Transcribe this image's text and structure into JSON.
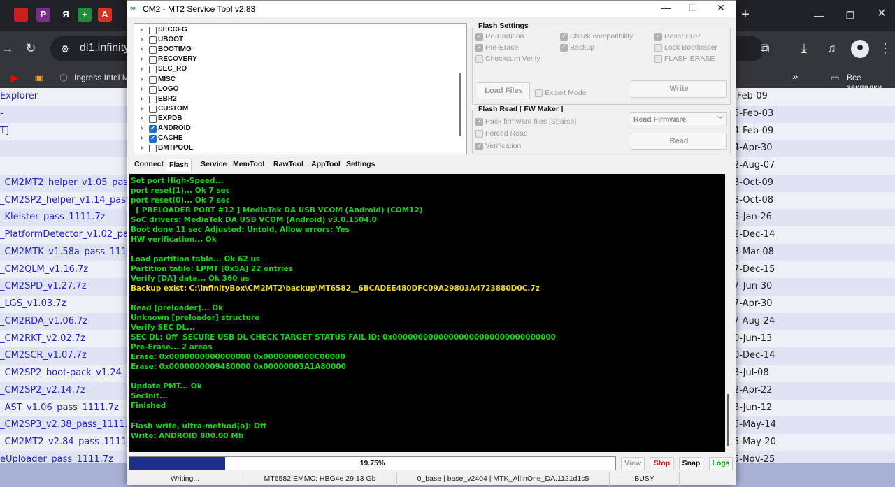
{
  "browser": {
    "tab_icons": [
      {
        "name": "tab-p",
        "glyph": "P",
        "color": "#7b2d8e"
      },
      {
        "name": "tab-y",
        "glyph": "Я",
        "color": "#202124"
      },
      {
        "name": "tab-plus",
        "glyph": "+",
        "color": "#1e8e3e"
      },
      {
        "name": "tab-a",
        "glyph": "A",
        "color": "#d93025"
      }
    ],
    "new_tab_symbol": "+",
    "address": "dl1.infinity",
    "bookmarks": [
      {
        "label": "Ingress Intel Ma"
      }
    ],
    "all_bookmarks_label": "Все закладки",
    "overflow_symbol": "»"
  },
  "page": {
    "rows": [
      {
        "name": "Explorer",
        "date": "-Feb-09",
        "alt": false
      },
      {
        "name": "-",
        "date": "5-Feb-03",
        "alt": true
      },
      {
        "name": "T]",
        "date": "4-Feb-09",
        "alt": false
      },
      {
        "name": "",
        "date": "4-Apr-30",
        "alt": true
      },
      {
        "name": "",
        "date": "2-Aug-07",
        "alt": false
      },
      {
        "name": "_CM2MT2_helper_v1.05_pass",
        "date": "3-Oct-09",
        "alt": true
      },
      {
        "name": "_CM2SP2_helper_v1.14_pass",
        "date": "3-Oct-08",
        "alt": false
      },
      {
        "name": "_Kleister_pass_1111.7z",
        "date": "5-Jan-26",
        "alt": true
      },
      {
        "name": "_PlatformDetector_v1.02_pas",
        "date": "2-Dec-14",
        "alt": false
      },
      {
        "name": "_CM2MTK_v1.58a_pass_1111",
        "date": "3-Mar-08",
        "alt": true
      },
      {
        "name": "_CM2QLM_v1.16.7z",
        "date": "7-Dec-15",
        "alt": false
      },
      {
        "name": "_CM2SPD_v1.27.7z",
        "date": "7-Jun-30",
        "alt": true
      },
      {
        "name": "_LGS_v1.03.7z",
        "date": "7-Apr-30",
        "alt": false
      },
      {
        "name": "_CM2RDA_v1.06.7z",
        "date": "7-Aug-24",
        "alt": true
      },
      {
        "name": "_CM2RKT_v2.02.7z",
        "date": "0-Jun-13",
        "alt": false
      },
      {
        "name": "_CM2SCR_v1.07.7z",
        "date": "0-Dec-14",
        "alt": true
      },
      {
        "name": "_CM2SP2_boot-pack_v1.24_p",
        "date": "3-Jul-08",
        "alt": false
      },
      {
        "name": "_CM2SP2_v2.14.7z",
        "date": "2-Apr-22",
        "alt": true
      },
      {
        "name": "_AST_v1.06_pass_1111.7z",
        "date": "3-Jun-12",
        "alt": false
      },
      {
        "name": "_CM2SP3_v2.38_pass_1111.",
        "date": "5-May-14",
        "alt": true
      },
      {
        "name": "_CM2MT2_v2.84_pass_1111.",
        "date": "5-May-20",
        "alt": false
      },
      {
        "name": "eUploader_pass_1111.7z",
        "date": "5-Nov-25",
        "alt": true
      }
    ]
  },
  "window": {
    "title": "CM2 - MT2 Service Tool v2.83",
    "controls": {
      "minimize": "—",
      "maximize": "☐",
      "close": "✕"
    },
    "partitions": [
      {
        "label": "SECCFG",
        "checked": false
      },
      {
        "label": "UBOOT",
        "checked": false
      },
      {
        "label": "BOOTIMG",
        "checked": false
      },
      {
        "label": "RECOVERY",
        "checked": false
      },
      {
        "label": "SEC_RO",
        "checked": false
      },
      {
        "label": "MISC",
        "checked": false
      },
      {
        "label": "LOGO",
        "checked": false
      },
      {
        "label": "EBR2",
        "checked": false
      },
      {
        "label": "CUSTOM",
        "checked": false
      },
      {
        "label": "EXPDB",
        "checked": false
      },
      {
        "label": "ANDROID",
        "checked": true
      },
      {
        "label": "CACHE",
        "checked": true
      },
      {
        "label": "BMTPOOL",
        "checked": false
      }
    ],
    "flash_settings": {
      "title": "Flash Settings",
      "options": {
        "re_partition": {
          "label": "Re-Partition",
          "checked": true
        },
        "pre_erase": {
          "label": "Pre-Erase",
          "checked": true
        },
        "checksum_verify": {
          "label": "Checksum Verify",
          "checked": false
        },
        "check_compat": {
          "label": "Check compatibility",
          "checked": true
        },
        "backup": {
          "label": "Backup",
          "checked": true
        },
        "reset_frp": {
          "label": "Reset FRP",
          "checked": true
        },
        "lock_bootloader": {
          "label": "Lock Bootloader",
          "checked": false
        },
        "flash_erase": {
          "label": "FLASH ERASE",
          "checked": false
        },
        "expert_mode": {
          "label": "Expert Mode",
          "checked": false
        }
      },
      "load_files_label": "Load Files",
      "write_label": "Write"
    },
    "flash_read": {
      "title": "Flash Read [ FW Maker ]",
      "options": {
        "pack_sparse": {
          "label": "Pack firmware files [Sparse]",
          "checked": true
        },
        "forced_read": {
          "label": "Forced Read",
          "checked": false
        },
        "verification": {
          "label": "Verification",
          "checked": true
        }
      },
      "mode_value": "Read Firmware",
      "read_label": "Read"
    },
    "tabs": [
      {
        "label": "Connect",
        "active": false
      },
      {
        "label": "Flash",
        "active": true
      },
      {
        "label": "Service",
        "active": false
      },
      {
        "label": "MemTool",
        "active": false
      },
      {
        "label": "RawTool",
        "active": false
      },
      {
        "label": "AppTool",
        "active": false
      },
      {
        "label": "Settings",
        "active": false
      }
    ],
    "log": [
      {
        "text": "Set port High-Speed...",
        "color": "green"
      },
      {
        "text": "port reset(1)... Ok 7 sec",
        "color": "green"
      },
      {
        "text": "port reset(0)... Ok 7 sec",
        "color": "green"
      },
      {
        "text": "  [ PRELOADER PORT #12 ] MediaTek DA USB VCOM (Android) (COM12)",
        "color": "green"
      },
      {
        "text": "SoC drivers: MediaTek DA USB VCOM (Android) v3.0.1504.0",
        "color": "green"
      },
      {
        "text": "Boot done 11 sec Adjusted: Untold, Allow errors: Yes",
        "color": "green"
      },
      {
        "text": "HW verification... Ok",
        "color": "green"
      },
      {
        "text": "",
        "color": "green"
      },
      {
        "text": "Load partition table... Ok 62 us",
        "color": "green"
      },
      {
        "text": "Partition table: LPMT [0x5A] 22 entries",
        "color": "green"
      },
      {
        "text": "Verify [DA] data... Ok 360 us",
        "color": "green"
      },
      {
        "text": "Backup exist: C:\\InfinityBox\\CM2MT2\\backup\\MT6582__6BCADEE480DFC09A29803A4723880D0C.7z",
        "color": "yellow"
      },
      {
        "text": "",
        "color": "green"
      },
      {
        "text": "Read [preloader]... Ok",
        "color": "green"
      },
      {
        "text": "Unknown [preloader] structure",
        "color": "green"
      },
      {
        "text": "Verify SEC DL...",
        "color": "green"
      },
      {
        "text": "SEC DL: Off  SECURE USB DL CHECK TARGET STATUS FAIL ID: 0x00000000000000000000000000000000",
        "color": "green"
      },
      {
        "text": "Pre-Erase... 2 areas",
        "color": "green"
      },
      {
        "text": "Erase: 0x0000000000000000 0x0000000000C00000",
        "color": "green"
      },
      {
        "text": "Erase: 0x0000000009480000 0x00000003A1A80000",
        "color": "green"
      },
      {
        "text": "",
        "color": "green"
      },
      {
        "text": "Update PMT... Ok",
        "color": "green"
      },
      {
        "text": "SecInit...",
        "color": "green"
      },
      {
        "text": "Finished",
        "color": "green"
      },
      {
        "text": "",
        "color": "green"
      },
      {
        "text": "Flash write, ultra-method(a): Off",
        "color": "green"
      },
      {
        "text": "Write: ANDROID 800.00 Mb",
        "color": "green"
      }
    ],
    "progress": {
      "fraction": 0.1975,
      "text": "19.75%"
    },
    "buttons": {
      "view": {
        "label": "View",
        "color": "#999999"
      },
      "stop": {
        "label": "Stop",
        "color": "#d11a1a"
      },
      "snap": {
        "label": "Snap",
        "color": "#111111"
      },
      "logs": {
        "label": "Logs",
        "color": "#12a012"
      }
    },
    "status": {
      "state": "Writing...",
      "device": "MT6582 EMMC: HBG4e 29.13 Gb",
      "build": "0_base | base_v2404 | MTK_AllInOne_DA.1121d1c5",
      "busy": "BUSY"
    }
  }
}
